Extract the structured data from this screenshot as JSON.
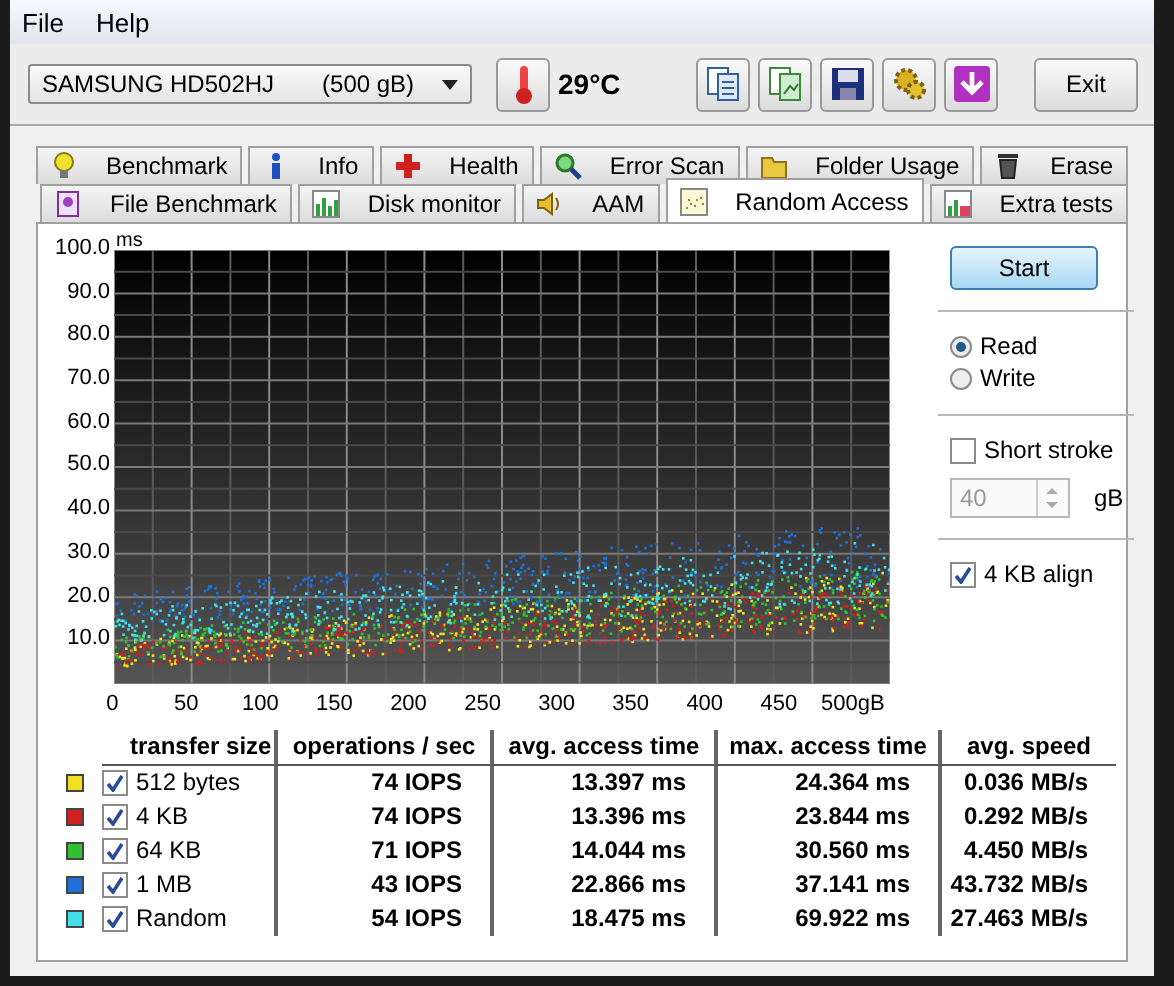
{
  "menu": [
    {
      "label": "File"
    },
    {
      "label": "Help"
    }
  ],
  "toolbar": {
    "drive": "SAMSUNG HD502HJ",
    "capacity": "(500 gB)",
    "temperature": "29°C",
    "exit": "Exit"
  },
  "tabs": [
    [
      {
        "label": "Benchmark",
        "selected": false
      },
      {
        "label": "Info",
        "selected": false
      },
      {
        "label": "Health",
        "selected": false
      },
      {
        "label": "Error Scan",
        "selected": false
      },
      {
        "label": "Folder Usage",
        "selected": false
      },
      {
        "label": "Erase",
        "selected": false
      }
    ],
    [
      {
        "label": "File Benchmark",
        "selected": false
      },
      {
        "label": "Disk monitor",
        "selected": false
      },
      {
        "label": "AAM",
        "selected": false
      },
      {
        "label": "Random Access",
        "selected": true
      },
      {
        "label": "Extra tests",
        "selected": false
      }
    ]
  ],
  "chart": {
    "unit": "ms",
    "y_labels": [
      "100.0",
      "90.0",
      "80.0",
      "70.0",
      "60.0",
      "50.0",
      "40.0",
      "30.0",
      "20.0",
      "10.0"
    ],
    "x_labels": [
      "0",
      "50",
      "100",
      "150",
      "200",
      "250",
      "300",
      "350",
      "400",
      "450",
      "500gB"
    ]
  },
  "controls": {
    "start": "Start",
    "modes": [
      {
        "label": "Read",
        "selected": true
      },
      {
        "label": "Write",
        "selected": false
      }
    ],
    "short_stroke": {
      "label": "Short stroke",
      "checked": false
    },
    "stroke_size": {
      "value": "40",
      "unit": "gB",
      "disabled": true
    },
    "align": {
      "label": "4 KB align",
      "checked": true
    }
  },
  "table": {
    "columns": [
      "transfer size",
      "operations / sec",
      "avg. access time",
      "max. access time",
      "avg. speed"
    ],
    "rows": [
      {
        "color": "#f0e020",
        "checked": true,
        "size": "512 bytes",
        "ops": "74 IOPS",
        "avg": "13.397 ms",
        "max": "24.364 ms",
        "speed": "0.036 MB/s"
      },
      {
        "color": "#d02020",
        "checked": true,
        "size": "4 KB",
        "ops": "74 IOPS",
        "avg": "13.396 ms",
        "max": "23.844 ms",
        "speed": "0.292 MB/s"
      },
      {
        "color": "#30c030",
        "checked": true,
        "size": "64 KB",
        "ops": "71 IOPS",
        "avg": "14.044 ms",
        "max": "30.560 ms",
        "speed": "4.450 MB/s"
      },
      {
        "color": "#2070d8",
        "checked": true,
        "size": "1 MB",
        "ops": "43 IOPS",
        "avg": "22.866 ms",
        "max": "37.141 ms",
        "speed": "43.732 MB/s"
      },
      {
        "color": "#40e0e8",
        "checked": true,
        "size": "Random",
        "ops": "54 IOPS",
        "avg": "18.475 ms",
        "max": "69.922 ms",
        "speed": "27.463 MB/s"
      }
    ]
  }
}
